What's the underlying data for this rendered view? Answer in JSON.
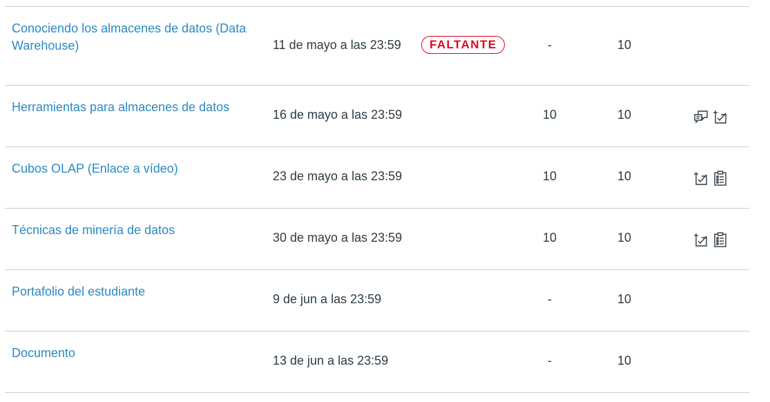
{
  "assignments": [
    {
      "title": "Conociendo los almacenes de datos (Data Warehouse)",
      "due": "11 de mayo a las 23:59",
      "status": "FALTANTE",
      "score": "-",
      "possible": "10",
      "icons": []
    },
    {
      "title": "Herramientas para almacenes de datos",
      "due": "16 de mayo a las 23:59",
      "status": "",
      "score": "10",
      "possible": "10",
      "icons": [
        "comments-icon",
        "rubric-icon"
      ]
    },
    {
      "title": "Cubos OLAP (Enlace a vídeo)",
      "due": "23 de mayo a las 23:59",
      "status": "",
      "score": "10",
      "possible": "10",
      "icons": [
        "rubric-icon",
        "details-icon"
      ]
    },
    {
      "title": "Técnicas de minería de datos",
      "due": "30 de mayo a las 23:59",
      "status": "",
      "score": "10",
      "possible": "10",
      "icons": [
        "rubric-icon",
        "details-icon"
      ]
    },
    {
      "title": "Portafolio del estudiante",
      "due": "9 de jun a las 23:59",
      "status": "",
      "score": "-",
      "possible": "10",
      "icons": []
    },
    {
      "title": "Documento",
      "due": "13 de jun a las 23:59",
      "status": "",
      "score": "-",
      "possible": "10",
      "icons": []
    }
  ],
  "colors": {
    "link": "#2b8ac2",
    "missing": "#e0061f",
    "text": "#2d3b45",
    "divider": "#c7cdd1"
  }
}
